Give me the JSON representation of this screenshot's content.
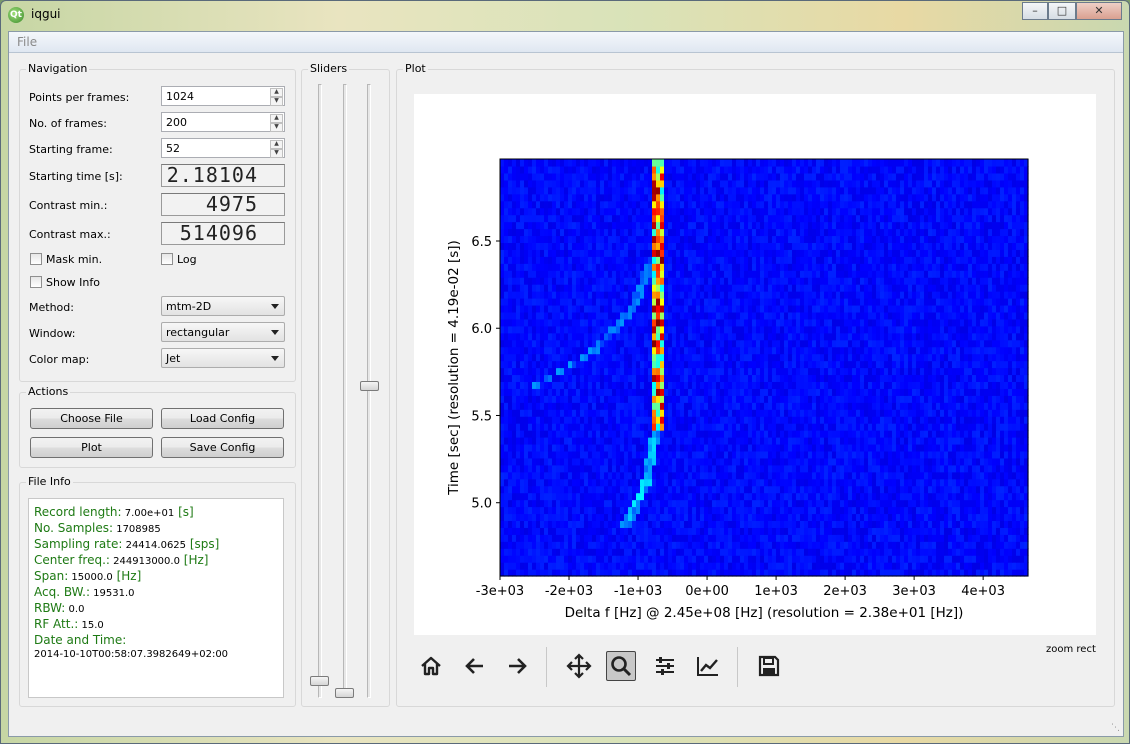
{
  "window": {
    "title": "iqgui",
    "app_icon": "qt-logo-icon"
  },
  "menu": {
    "file": "File"
  },
  "navigation": {
    "title": "Navigation",
    "points_label": "Points per frames:",
    "points_value": "1024",
    "frames_label": "No. of frames:",
    "frames_value": "200",
    "start_frame_label": "Starting frame:",
    "start_frame_value": "52",
    "start_time_label": "Starting time [s]:",
    "start_time_value": "2.18104",
    "contrast_min_label": "Contrast min.:",
    "contrast_min_value": "4975",
    "contrast_max_label": "Contrast max.:",
    "contrast_max_value": "514096",
    "mask_min_label": "Mask min.",
    "log_label": "Log",
    "show_info_label": "Show Info",
    "method_label": "Method:",
    "method_value": "mtm-2D",
    "window_label": "Window:",
    "window_value": "rectangular",
    "cmap_label": "Color map:",
    "cmap_value": "Jet"
  },
  "actions": {
    "title": "Actions",
    "choose_file": "Choose File",
    "load_config": "Load Config",
    "plot": "Plot",
    "save_config": "Save Config"
  },
  "file_info": {
    "title": "File Info",
    "rows": [
      {
        "key": "Record length:",
        "value": "7.00e+01",
        "unit": "[s]"
      },
      {
        "key": "No. Samples:",
        "value": "1708985",
        "unit": ""
      },
      {
        "key": "Sampling rate:",
        "value": "24414.0625",
        "unit": "[sps]"
      },
      {
        "key": "Center freq.:",
        "value": "244913000.0",
        "unit": "[Hz]"
      },
      {
        "key": "Span:",
        "value": "15000.0",
        "unit": "[Hz]"
      },
      {
        "key": "Acq. BW.:",
        "value": "19531.0",
        "unit": ""
      },
      {
        "key": "RBW:",
        "value": "0.0",
        "unit": ""
      },
      {
        "key": "RF Att.:",
        "value": "15.0",
        "unit": ""
      },
      {
        "key": "Date and Time:",
        "value": "",
        "unit": ""
      }
    ],
    "datetime": "2014-10-10T00:58:07.3982649+02:00"
  },
  "sliders": {
    "title": "Sliders",
    "levels": [
      0.02,
      0.0,
      0.51
    ]
  },
  "plot": {
    "title": "Plot",
    "status": "zoom rect"
  },
  "toolbar": {
    "icons": [
      "home-icon",
      "back-arrow-icon",
      "forward-arrow-icon",
      "pan-icon",
      "zoom-icon",
      "configure-subplots-icon",
      "edit-axes-icon",
      "save-icon"
    ],
    "active": "zoom-icon"
  },
  "chart_data": {
    "type": "heatmap",
    "title": "",
    "xlabel": "Delta f [Hz] @ 2.45e+08 [Hz] (resolution = 2.38e+01 [Hz])",
    "ylabel": "Time [sec] (resolution = 4.19e-02 [s])",
    "xlim": [
      -3000,
      4650
    ],
    "ylim": [
      4.58,
      6.97
    ],
    "x_ticks": [
      -3000,
      -2000,
      -1000,
      0,
      1000,
      2000,
      3000,
      4000
    ],
    "x_tick_labels": [
      "-3e+03",
      "-2e+03",
      "-1e+03",
      "0e+00",
      "1e+03",
      "2e+03",
      "3e+03",
      "4e+03"
    ],
    "y_ticks": [
      5.0,
      5.5,
      6.0,
      6.5
    ],
    "y_tick_labels": [
      "5.0",
      "5.5",
      "6.0",
      "6.5"
    ],
    "colormap": "jet",
    "background_level": "low (dark blue)",
    "features": [
      {
        "name": "carrier line",
        "x": -700,
        "y_range": [
          5.4,
          6.97
        ],
        "intensity": "high"
      },
      {
        "name": "chirp curve",
        "points": [
          [
            -1200,
            4.85
          ],
          [
            -900,
            5.1
          ],
          [
            -800,
            5.3
          ],
          [
            -720,
            5.45
          ],
          [
            -700,
            5.6
          ]
        ]
      },
      {
        "name": "left branch",
        "points": [
          [
            -2600,
            5.65
          ],
          [
            -1700,
            5.85
          ],
          [
            -1100,
            6.1
          ],
          [
            -800,
            6.4
          ]
        ]
      }
    ]
  }
}
